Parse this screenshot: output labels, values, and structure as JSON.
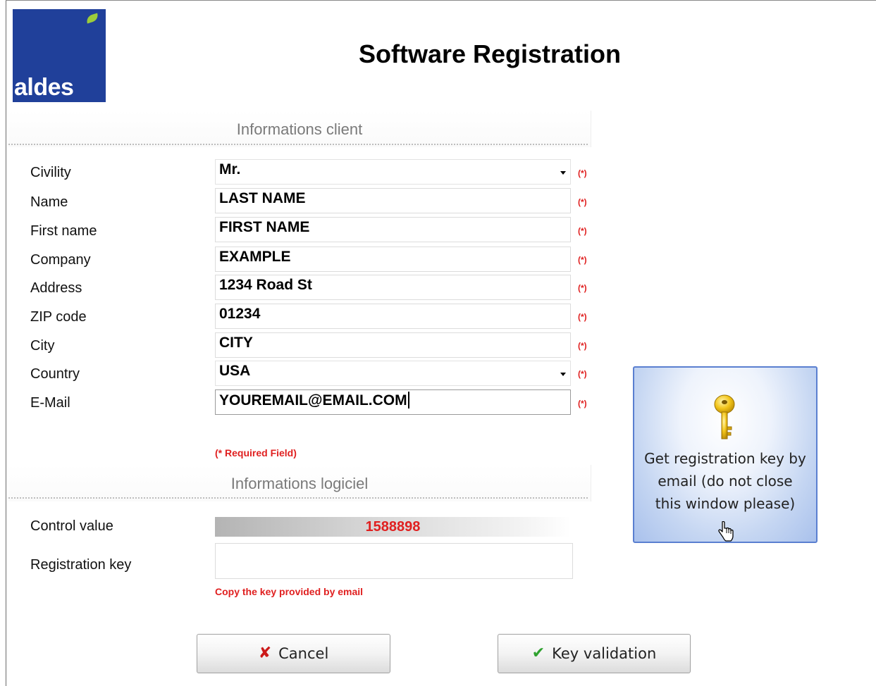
{
  "logo": {
    "text": "aldes"
  },
  "title": "Software Registration",
  "client_section": {
    "title": "Informations client",
    "fields": [
      {
        "label": "Civility",
        "value": "Mr.",
        "type": "select",
        "required_mark": "(*)"
      },
      {
        "label": "Name",
        "value": "LAST NAME",
        "type": "text",
        "required_mark": "(*)"
      },
      {
        "label": "First name",
        "value": "FIRST NAME",
        "type": "text",
        "required_mark": "(*)"
      },
      {
        "label": "Company",
        "value": "EXAMPLE",
        "type": "text",
        "required_mark": "(*)"
      },
      {
        "label": "Address",
        "value": "1234 Road St",
        "type": "text",
        "required_mark": "(*)"
      },
      {
        "label": "ZIP code",
        "value": "01234",
        "type": "text",
        "required_mark": "(*)"
      },
      {
        "label": "City",
        "value": "CITY",
        "type": "text",
        "required_mark": "(*)"
      },
      {
        "label": "Country",
        "value": "USA",
        "type": "select",
        "required_mark": "(*)"
      },
      {
        "label": "E-Mail",
        "value": "YOUREMAIL@EMAIL.COM",
        "type": "text",
        "required_mark": "(*)"
      }
    ],
    "required_note": "(* Required Field)"
  },
  "software_section": {
    "title": "Informations logiciel",
    "control_label": "Control value",
    "control_value": "1588898",
    "key_label": "Registration key",
    "key_value": "",
    "key_note": "Copy the key provided by email"
  },
  "get_key_button": {
    "line1": "Get registration key by",
    "line2": "email (do not close",
    "line3": "this window please)",
    "icon": "key-icon"
  },
  "buttons": {
    "cancel": "Cancel",
    "validate": "Key validation"
  },
  "colors": {
    "brand_blue": "#20409a",
    "brand_leaf": "#9ccc3b",
    "required_red": "#e02020",
    "button_border": "#5a7fd0"
  }
}
